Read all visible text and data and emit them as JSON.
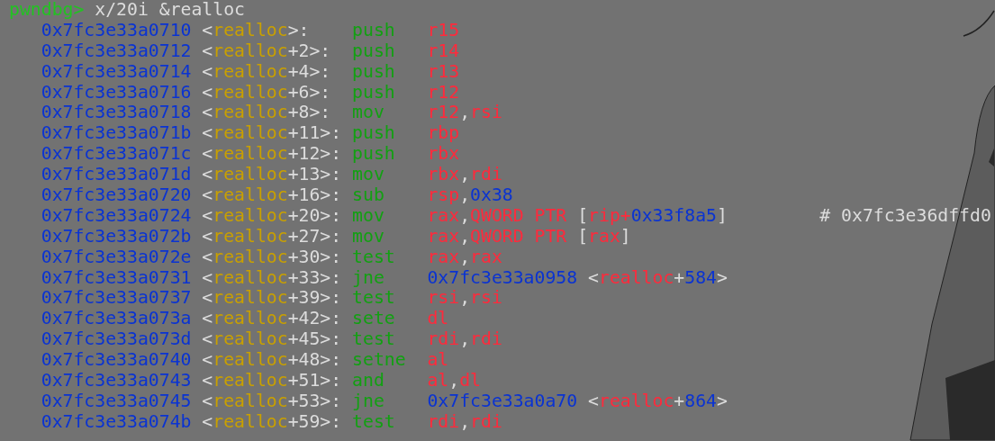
{
  "prompt": {
    "text": "pwndbg>",
    "command": "x/20i &realloc"
  },
  "rows": [
    {
      "address": "0x7fc3e33a0710",
      "label": {
        "pre": "<",
        "func": "realloc",
        "post": ">:"
      },
      "mnemonic": "push",
      "operands": [
        {
          "text": "r15",
          "kind": "reg"
        }
      ]
    },
    {
      "address": "0x7fc3e33a0712",
      "label": {
        "pre": "<",
        "func": "realloc",
        "post": "+2>:"
      },
      "mnemonic": "push",
      "operands": [
        {
          "text": "r14",
          "kind": "reg"
        }
      ]
    },
    {
      "address": "0x7fc3e33a0714",
      "label": {
        "pre": "<",
        "func": "realloc",
        "post": "+4>:"
      },
      "mnemonic": "push",
      "operands": [
        {
          "text": "r13",
          "kind": "reg"
        }
      ]
    },
    {
      "address": "0x7fc3e33a0716",
      "label": {
        "pre": "<",
        "func": "realloc",
        "post": "+6>:"
      },
      "mnemonic": "push",
      "operands": [
        {
          "text": "r12",
          "kind": "reg"
        }
      ]
    },
    {
      "address": "0x7fc3e33a0718",
      "label": {
        "pre": "<",
        "func": "realloc",
        "post": "+8>:"
      },
      "mnemonic": "mov",
      "operands": [
        {
          "text": "r12",
          "kind": "reg"
        },
        {
          "text": ",",
          "kind": "plain"
        },
        {
          "text": "rsi",
          "kind": "reg"
        }
      ]
    },
    {
      "address": "0x7fc3e33a071b",
      "label": {
        "pre": "<",
        "func": "realloc",
        "post": "+11>:"
      },
      "mnemonic": "push",
      "operands": [
        {
          "text": "rbp",
          "kind": "reg"
        }
      ]
    },
    {
      "address": "0x7fc3e33a071c",
      "label": {
        "pre": "<",
        "func": "realloc",
        "post": "+12>:"
      },
      "mnemonic": "push",
      "operands": [
        {
          "text": "rbx",
          "kind": "reg"
        }
      ]
    },
    {
      "address": "0x7fc3e33a071d",
      "label": {
        "pre": "<",
        "func": "realloc",
        "post": "+13>:"
      },
      "mnemonic": "mov",
      "operands": [
        {
          "text": "rbx",
          "kind": "reg"
        },
        {
          "text": ",",
          "kind": "plain"
        },
        {
          "text": "rdi",
          "kind": "reg"
        }
      ]
    },
    {
      "address": "0x7fc3e33a0720",
      "label": {
        "pre": "<",
        "func": "realloc",
        "post": "+16>:"
      },
      "mnemonic": "sub",
      "operands": [
        {
          "text": "rsp",
          "kind": "reg"
        },
        {
          "text": ",",
          "kind": "plain"
        },
        {
          "text": "0x38",
          "kind": "num"
        }
      ]
    },
    {
      "address": "0x7fc3e33a0724",
      "label": {
        "pre": "<",
        "func": "realloc",
        "post": "+20>:"
      },
      "mnemonic": "mov",
      "operands": [
        {
          "text": "rax",
          "kind": "reg"
        },
        {
          "text": ",",
          "kind": "plain"
        },
        {
          "text": "QWORD PTR",
          "kind": "reg"
        },
        {
          "text": " [",
          "kind": "plain"
        },
        {
          "text": "rip+",
          "kind": "reg"
        },
        {
          "text": "0x33f8a5",
          "kind": "num"
        },
        {
          "text": "]",
          "kind": "plain"
        }
      ],
      "comment": "# 0x7fc3e36dffd0"
    },
    {
      "address": "0x7fc3e33a072b",
      "label": {
        "pre": "<",
        "func": "realloc",
        "post": "+27>:"
      },
      "mnemonic": "mov",
      "operands": [
        {
          "text": "rax",
          "kind": "reg"
        },
        {
          "text": ",",
          "kind": "plain"
        },
        {
          "text": "QWORD PTR",
          "kind": "reg"
        },
        {
          "text": " [",
          "kind": "plain"
        },
        {
          "text": "rax",
          "kind": "reg"
        },
        {
          "text": "]",
          "kind": "plain"
        }
      ]
    },
    {
      "address": "0x7fc3e33a072e",
      "label": {
        "pre": "<",
        "func": "realloc",
        "post": "+30>:"
      },
      "mnemonic": "test",
      "operands": [
        {
          "text": "rax",
          "kind": "reg"
        },
        {
          "text": ",",
          "kind": "plain"
        },
        {
          "text": "rax",
          "kind": "reg"
        }
      ]
    },
    {
      "address": "0x7fc3e33a0731",
      "label": {
        "pre": "<",
        "func": "realloc",
        "post": "+33>:"
      },
      "mnemonic": "jne",
      "operands": [
        {
          "text": "0x7fc3e33a0958",
          "kind": "num"
        },
        {
          "text": " <",
          "kind": "plain"
        },
        {
          "text": "realloc",
          "kind": "reg"
        },
        {
          "text": "+",
          "kind": "plain"
        },
        {
          "text": "584",
          "kind": "num"
        },
        {
          "text": ">",
          "kind": "plain"
        }
      ]
    },
    {
      "address": "0x7fc3e33a0737",
      "label": {
        "pre": "<",
        "func": "realloc",
        "post": "+39>:"
      },
      "mnemonic": "test",
      "operands": [
        {
          "text": "rsi",
          "kind": "reg"
        },
        {
          "text": ",",
          "kind": "plain"
        },
        {
          "text": "rsi",
          "kind": "reg"
        }
      ]
    },
    {
      "address": "0x7fc3e33a073a",
      "label": {
        "pre": "<",
        "func": "realloc",
        "post": "+42>:"
      },
      "mnemonic": "sete",
      "operands": [
        {
          "text": "dl",
          "kind": "reg"
        }
      ]
    },
    {
      "address": "0x7fc3e33a073d",
      "label": {
        "pre": "<",
        "func": "realloc",
        "post": "+45>:"
      },
      "mnemonic": "test",
      "operands": [
        {
          "text": "rdi",
          "kind": "reg"
        },
        {
          "text": ",",
          "kind": "plain"
        },
        {
          "text": "rdi",
          "kind": "reg"
        }
      ]
    },
    {
      "address": "0x7fc3e33a0740",
      "label": {
        "pre": "<",
        "func": "realloc",
        "post": "+48>:"
      },
      "mnemonic": "setne",
      "operands": [
        {
          "text": "al",
          "kind": "reg"
        }
      ]
    },
    {
      "address": "0x7fc3e33a0743",
      "label": {
        "pre": "<",
        "func": "realloc",
        "post": "+51>:"
      },
      "mnemonic": "and",
      "operands": [
        {
          "text": "al",
          "kind": "reg"
        },
        {
          "text": ",",
          "kind": "plain"
        },
        {
          "text": "dl",
          "kind": "reg"
        }
      ]
    },
    {
      "address": "0x7fc3e33a0745",
      "label": {
        "pre": "<",
        "func": "realloc",
        "post": "+53>:"
      },
      "mnemonic": "jne",
      "operands": [
        {
          "text": "0x7fc3e33a0a70",
          "kind": "num"
        },
        {
          "text": " <",
          "kind": "plain"
        },
        {
          "text": "realloc",
          "kind": "reg"
        },
        {
          "text": "+",
          "kind": "plain"
        },
        {
          "text": "864",
          "kind": "num"
        },
        {
          "text": ">",
          "kind": "plain"
        }
      ]
    },
    {
      "address": "0x7fc3e33a074b",
      "label": {
        "pre": "<",
        "func": "realloc",
        "post": "+59>:"
      },
      "mnemonic": "test",
      "operands": [
        {
          "text": "rdi",
          "kind": "reg"
        },
        {
          "text": ",",
          "kind": "plain"
        },
        {
          "text": "rdi",
          "kind": "reg"
        }
      ]
    }
  ]
}
